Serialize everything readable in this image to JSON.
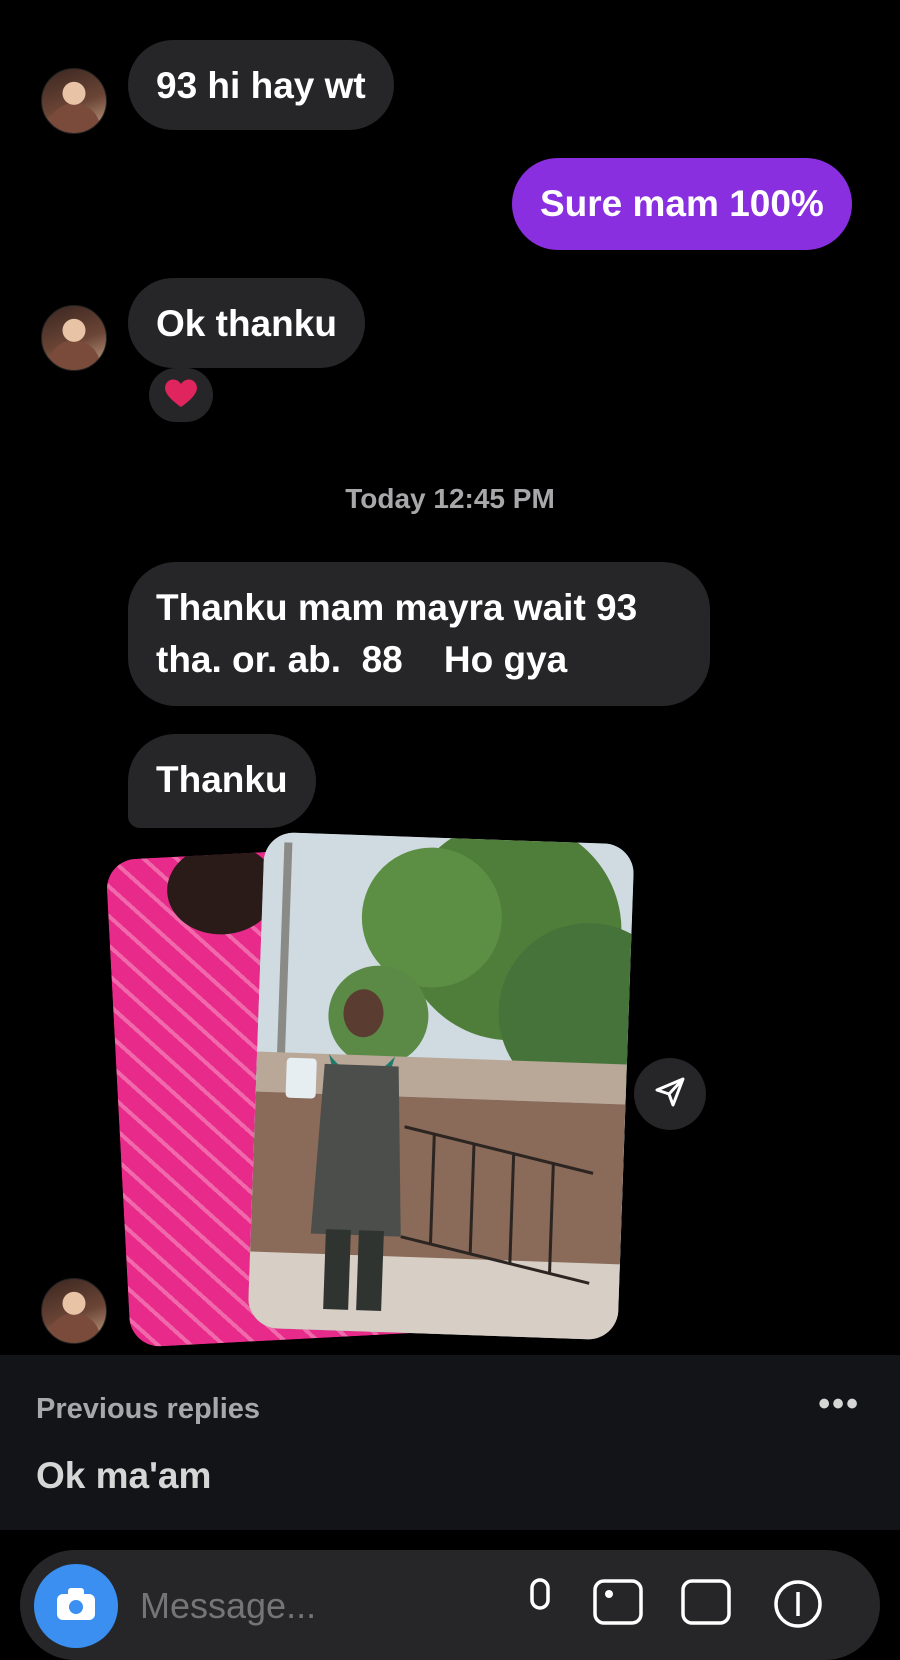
{
  "messages": [
    {
      "text": "93 hi hay wt",
      "direction": "received"
    },
    {
      "text": "Sure mam 100%",
      "direction": "sent"
    },
    {
      "text": "Ok thanku",
      "direction": "received",
      "reaction": "heart"
    },
    {
      "text": "Thanku mam mayra wait 93\ntha. or. ab.  88    Ho gya",
      "direction": "received"
    },
    {
      "text": "Thanku",
      "direction": "received"
    }
  ],
  "timestamp": "Today 12:45 PM",
  "previous_replies": {
    "title": "Previous replies",
    "more": "•••",
    "item": "Ok ma'am"
  },
  "composer": {
    "placeholder": "Message..."
  },
  "colors": {
    "background": "#000000",
    "received_bubble": "#262629",
    "sent_bubble": "#8a2fe0",
    "camera_button": "#3a8ff0",
    "reaction_heart": "#e0245e"
  },
  "icons": [
    "avatar",
    "heart-icon",
    "share-icon",
    "camera-icon",
    "mic-icon",
    "gallery-icon",
    "sticker-icon",
    "add-icon"
  ]
}
